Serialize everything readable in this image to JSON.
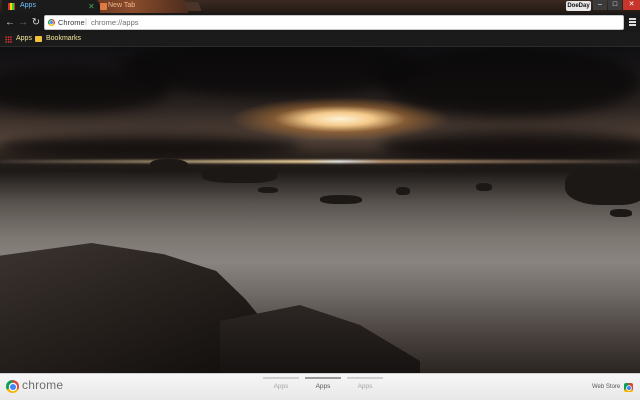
{
  "tabs": [
    {
      "title": "Apps",
      "icon": "apps-grid-icon",
      "active": true
    },
    {
      "title": "New Tab",
      "icon": "page-icon",
      "active": false
    }
  ],
  "window": {
    "profile_name": "DoeDay",
    "minimize": "–",
    "maximize": "□",
    "close": "✕"
  },
  "toolbar": {
    "back": "←",
    "forward": "→",
    "reload": "↻",
    "omnibox_scheme": "Chrome",
    "omnibox_separator": "|",
    "omnibox_url": "chrome://apps"
  },
  "bookmarks": [
    {
      "label": "Apps",
      "icon": "apps-grid-icon"
    },
    {
      "label": "Bookmarks",
      "icon": "folder-icon"
    }
  ],
  "bottom_bar": {
    "brand": "chrome",
    "pager": [
      "Apps",
      "Apps",
      "Apps"
    ],
    "active_page_index": 1,
    "webstore_label": "Web Store"
  },
  "colors": {
    "tab_title_active": "#6ec2ff",
    "bookmark_text": "#f2e69a",
    "close_button": "#c8362b"
  }
}
